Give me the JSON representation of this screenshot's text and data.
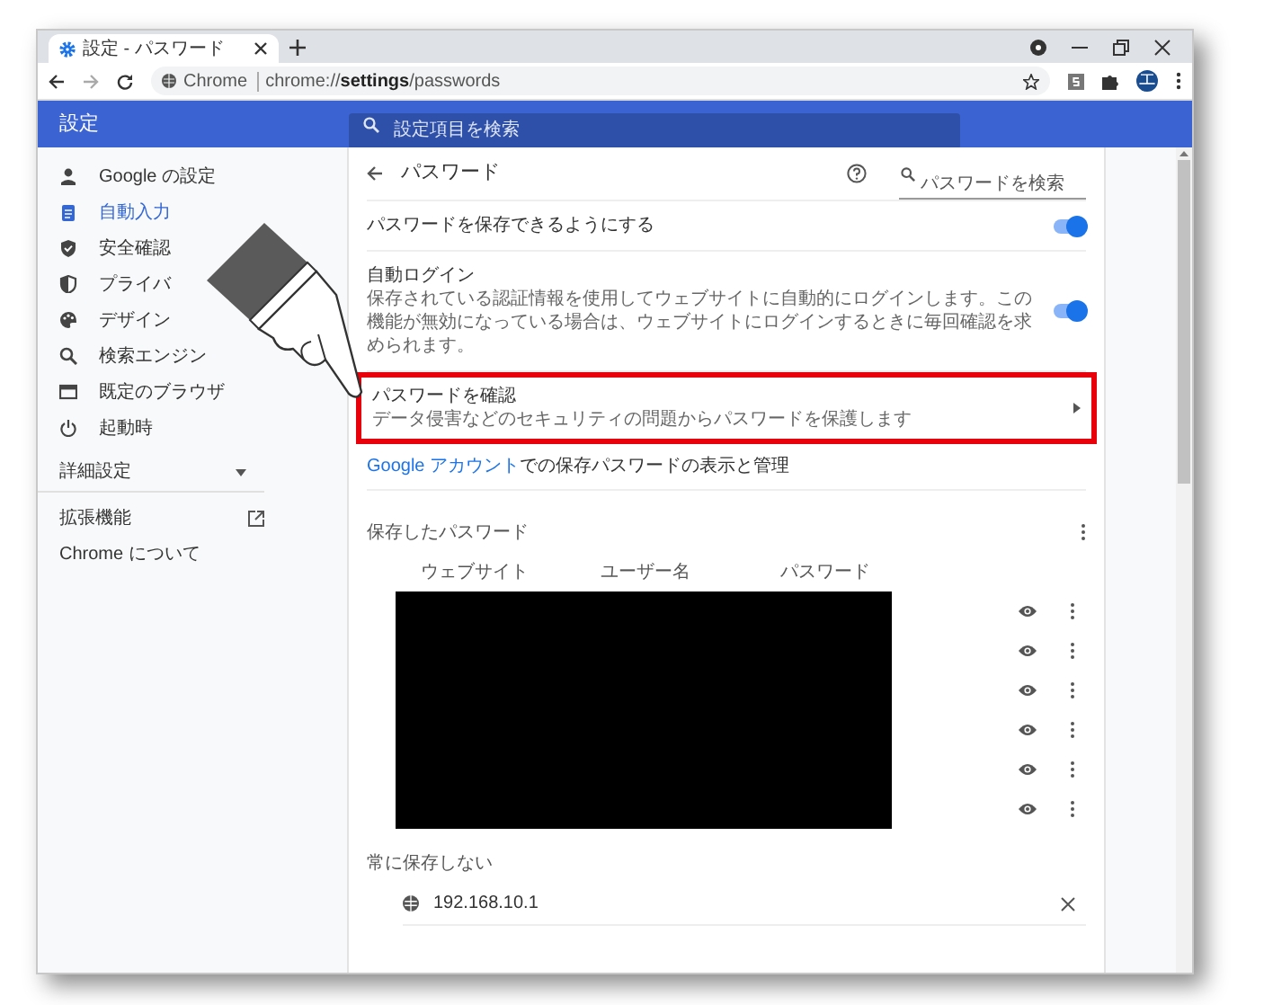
{
  "browser": {
    "tab_title": "設定 - パスワード",
    "url_label": "Chrome",
    "url": "chrome://**settings**/passwords",
    "avatar": "エ"
  },
  "header": {
    "title": "設定",
    "search_placeholder": "設定項目を検索"
  },
  "sidebar": {
    "items": [
      {
        "label": "Google の設定",
        "selected": false
      },
      {
        "label": "自動入力",
        "selected": true
      },
      {
        "label": "安全確認",
        "selected": false
      },
      {
        "label": "プライバ",
        "selected": false
      },
      {
        "label": "デザイン",
        "selected": false
      },
      {
        "label": "検索エンジン",
        "selected": false
      },
      {
        "label": "既定のブラウザ",
        "selected": false
      },
      {
        "label": "起動時",
        "selected": false
      }
    ],
    "advanced": {
      "label": "詳細設定",
      "expanded": false
    },
    "links": [
      {
        "label": "拡張機能",
        "external": true
      },
      {
        "label": "Chrome について",
        "external": false
      }
    ]
  },
  "page": {
    "title": "パスワード",
    "search_placeholder": "パスワードを検索",
    "settings": [
      {
        "kind": "toggle",
        "label": "パスワードを保存できるようにする",
        "on": true
      },
      {
        "kind": "toggle",
        "label": "自動ログイン",
        "description": "保存されている認証情報を使用してウェブサイトに自動的にログインします。この機能が無効になっている場合は、ウェブサイトにログインするときに毎回確認を求められます。",
        "on": true
      },
      {
        "kind": "link",
        "label": "パスワードを確認",
        "description": "データ侵害などのセキュリティの問題からパスワードを保護します",
        "highlighted": true
      }
    ],
    "account_link": "Google アカウント",
    "account_note": "での保存パスワードの表示と管理",
    "saved": {
      "title": "保存したパスワード",
      "columns": [
        "ウェブサイト",
        "ユーザー名",
        "パスワード"
      ],
      "rows": [
        {
          "redacted": true
        },
        {
          "redacted": true
        },
        {
          "redacted": true
        },
        {
          "redacted": true
        },
        {
          "redacted": true
        },
        {
          "redacted": true
        }
      ]
    },
    "never_saved": {
      "title": "常に保存しない",
      "sites": [
        "192.168.10.1"
      ]
    }
  }
}
